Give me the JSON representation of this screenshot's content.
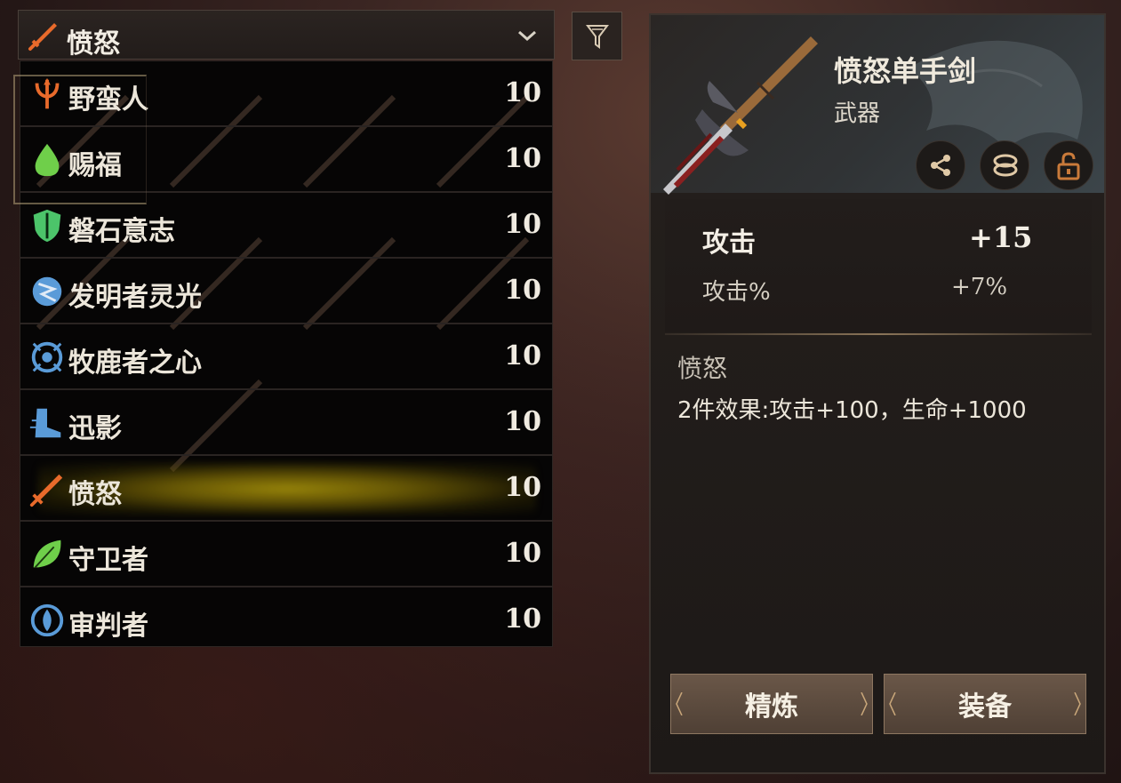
{
  "filter": {
    "selected_label": "愤怒",
    "selected_icon": "fury-sword-icon"
  },
  "set_list": [
    {
      "label": "野蛮人",
      "count": "10",
      "icon": "barbarian-trident-icon",
      "color": "#e86a2b"
    },
    {
      "label": "赐福",
      "count": "10",
      "icon": "blessing-drop-icon",
      "color": "#6fcf4a"
    },
    {
      "label": "磐石意志",
      "count": "10",
      "icon": "rock-will-shield-icon",
      "color": "#4cc46a"
    },
    {
      "label": "发明者灵光",
      "count": "10",
      "icon": "inventor-spark-icon",
      "color": "#5a9bd8"
    },
    {
      "label": "牧鹿者之心",
      "count": "10",
      "icon": "deer-heart-icon",
      "color": "#5a9bd8"
    },
    {
      "label": "迅影",
      "count": "10",
      "icon": "swift-boot-icon",
      "color": "#5a9bd8"
    },
    {
      "label": "愤怒",
      "count": "10",
      "icon": "fury-sword-icon",
      "color": "#e86a2b",
      "selected": true
    },
    {
      "label": "守卫者",
      "count": "10",
      "icon": "guardian-leaf-icon",
      "color": "#6fcf4a"
    },
    {
      "label": "审判者",
      "count": "10",
      "icon": "judge-eye-icon",
      "color": "#5a9bd8"
    }
  ],
  "item": {
    "name": "愤怒单手剑",
    "type": "武器",
    "stats": {
      "main_label": "攻击",
      "main_value": "+15",
      "sub_label": "攻击%",
      "sub_value": "+7%"
    },
    "set_name": "愤怒",
    "set_effect": "2件效果:攻击+100，生命+1000"
  },
  "actions": {
    "refine": "精炼",
    "equip": "装备"
  },
  "colors": {
    "selected_glow": "#a08c0a",
    "button_bg": "#5d4b3e"
  }
}
